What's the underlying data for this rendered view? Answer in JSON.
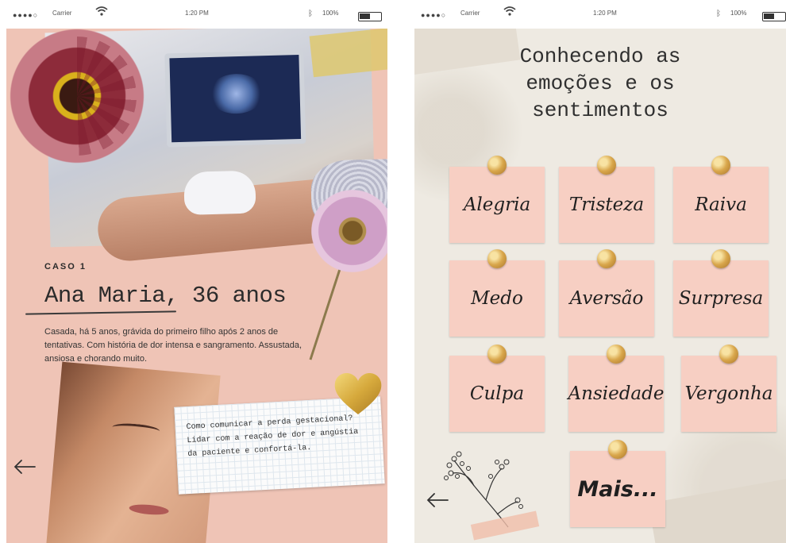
{
  "status_bar": {
    "carrier": "Carrier",
    "time": "1:20 PM",
    "battery": "100%"
  },
  "left_screen": {
    "case_label": "CASO 1",
    "patient_name": "Ana Maria, 36 anos",
    "description": "Casada, há 5 anos, grávida do primeiro filho após 2 anos de tentativas. Com história de dor intensa e sangramento. Assustada, ansiosa e chorando muito.",
    "note_lines": [
      "Como comunicar a perda gestacional?",
      "Lidar com a reação de dor e angústia",
      "da paciente e confortá-la."
    ],
    "back_icon": "arrow-left-icon"
  },
  "right_screen": {
    "title_lines": [
      "Conhecendo as",
      "emoções e os",
      "sentimentos"
    ],
    "emotions": [
      "Alegria",
      "Tristeza",
      "Raiva",
      "Medo",
      "Aversão",
      "Surpresa",
      "Culpa",
      "Ansiedade",
      "Vergonha"
    ],
    "more_label": "Mais...",
    "back_icon": "arrow-left-icon"
  },
  "colors": {
    "left_background": "#efc4b6",
    "card_pink": "#f7cfc3",
    "pin_gold": "#d9a74c",
    "right_background": "#eeeae2"
  }
}
